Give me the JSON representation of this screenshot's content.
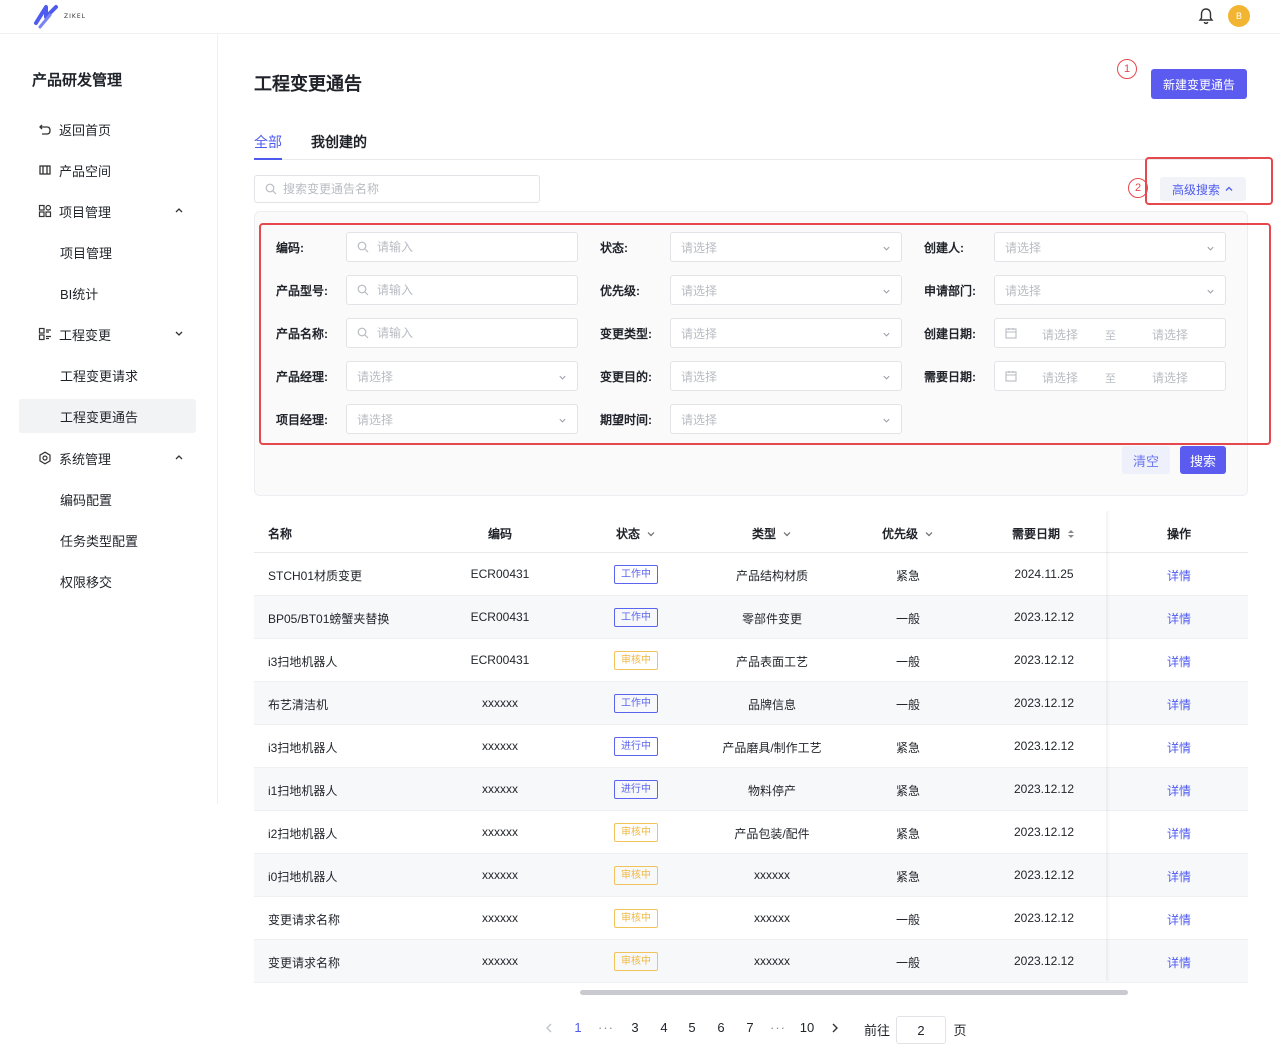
{
  "app": {
    "logo_text": "ZIKEL",
    "avatar_initial": "B"
  },
  "sidebar": {
    "title": "产品研发管理",
    "items": [
      {
        "label": "返回首页",
        "icon": "return-icon"
      },
      {
        "label": "产品空间",
        "icon": "product-space-icon"
      },
      {
        "label": "项目管理",
        "icon": "grid-icon",
        "expanded": true
      },
      {
        "label": "项目管理",
        "sub": true
      },
      {
        "label": "BI统计",
        "sub": true
      },
      {
        "label": "工程变更",
        "icon": "list-icon",
        "expanded": true
      },
      {
        "label": "工程变更请求",
        "sub": true
      },
      {
        "label": "工程变更通告",
        "sub": true,
        "active": true
      },
      {
        "label": "系统管理",
        "icon": "gear-icon",
        "expanded": true
      },
      {
        "label": "编码配置",
        "sub": true
      },
      {
        "label": "任务类型配置",
        "sub": true
      },
      {
        "label": "权限移交",
        "sub": true
      }
    ]
  },
  "header": {
    "title": "工程变更通告",
    "new_button": "新建变更通告",
    "marker1": "1",
    "marker2": "2"
  },
  "tabs": [
    {
      "label": "全部",
      "active": true
    },
    {
      "label": "我创建的",
      "active": false
    }
  ],
  "search": {
    "placeholder": "搜索变更通告名称"
  },
  "advanced_search": {
    "label": "高级搜索"
  },
  "filters": {
    "code": {
      "label": "编码:",
      "placeholder": "请输入"
    },
    "model": {
      "label": "产品型号:",
      "placeholder": "请输入"
    },
    "product_name": {
      "label": "产品名称:",
      "placeholder": "请输入"
    },
    "product_manager": {
      "label": "产品经理:",
      "placeholder": "请选择"
    },
    "project_manager": {
      "label": "项目经理:",
      "placeholder": "请选择"
    },
    "status": {
      "label": "状态:",
      "placeholder": "请选择"
    },
    "priority": {
      "label": "优先级:",
      "placeholder": "请选择"
    },
    "change_type": {
      "label": "变更类型:",
      "placeholder": "请选择"
    },
    "change_purpose": {
      "label": "变更目的:",
      "placeholder": "请选择"
    },
    "expected_time": {
      "label": "期望时间:",
      "placeholder": "请选择"
    },
    "creator": {
      "label": "创建人:",
      "placeholder": "请选择"
    },
    "department": {
      "label": "申请部门:",
      "placeholder": "请选择"
    },
    "created_date": {
      "label": "创建日期:",
      "start": "请选择",
      "sep": "至",
      "end": "请选择"
    },
    "required_date": {
      "label": "需要日期:",
      "start": "请选择",
      "sep": "至",
      "end": "请选择"
    },
    "clear_button": "清空",
    "search_button": "搜索"
  },
  "table": {
    "columns": [
      "名称",
      "编码",
      "状态",
      "类型",
      "优先级",
      "需要日期",
      "操作"
    ],
    "rows": [
      {
        "name": "STCH01材质变更",
        "code": "ECR00431",
        "status": "工作中",
        "status_kind": "work",
        "type": "产品结构材质",
        "priority": "紧急",
        "date": "2024.11.25",
        "action": "详情"
      },
      {
        "name": "BP05/BT01螃蟹夹替换",
        "code": "ECR00431",
        "status": "工作中",
        "status_kind": "work",
        "type": "零部件变更",
        "priority": "一般",
        "date": "2023.12.12",
        "action": "详情"
      },
      {
        "name": "i3扫地机器人",
        "code": "ECR00431",
        "status": "审核中",
        "status_kind": "review",
        "type": "产品表面工艺",
        "priority": "一般",
        "date": "2023.12.12",
        "action": "详情"
      },
      {
        "name": "布艺清洁机",
        "code": "xxxxxx",
        "status": "工作中",
        "status_kind": "work",
        "type": "品牌信息",
        "priority": "一般",
        "date": "2023.12.12",
        "action": "详情"
      },
      {
        "name": "i3扫地机器人",
        "code": "xxxxxx",
        "status": "进行中",
        "status_kind": "work",
        "type": "产品磨具/制作工艺",
        "priority": "紧急",
        "date": "2023.12.12",
        "action": "详情"
      },
      {
        "name": "i1扫地机器人",
        "code": "xxxxxx",
        "status": "进行中",
        "status_kind": "work",
        "type": "物料停产",
        "priority": "紧急",
        "date": "2023.12.12",
        "action": "详情"
      },
      {
        "name": "i2扫地机器人",
        "code": "xxxxxx",
        "status": "审核中",
        "status_kind": "review",
        "type": "产品包装/配件",
        "priority": "紧急",
        "date": "2023.12.12",
        "action": "详情"
      },
      {
        "name": "i0扫地机器人",
        "code": "xxxxxx",
        "status": "审核中",
        "status_kind": "review",
        "type": "xxxxxx",
        "priority": "紧急",
        "date": "2023.12.12",
        "action": "详情"
      },
      {
        "name": "变更请求名称",
        "code": "xxxxxx",
        "status": "审核中",
        "status_kind": "review",
        "type": "xxxxxx",
        "priority": "一般",
        "date": "2023.12.12",
        "action": "详情"
      },
      {
        "name": "变更请求名称",
        "code": "xxxxxx",
        "status": "审核中",
        "status_kind": "review",
        "type": "xxxxxx",
        "priority": "一般",
        "date": "2023.12.12",
        "action": "详情"
      }
    ]
  },
  "pagination": {
    "pages": [
      "1",
      "···",
      "3",
      "4",
      "5",
      "6",
      "7",
      "···",
      "10"
    ],
    "current": "1",
    "goto_label": "前往",
    "goto_value": "2",
    "page_suffix": "页"
  },
  "colors": {
    "primary": "#5b5bf0",
    "link": "#4f5bef",
    "review": "#f0b842",
    "highlight": "#e5484d"
  }
}
